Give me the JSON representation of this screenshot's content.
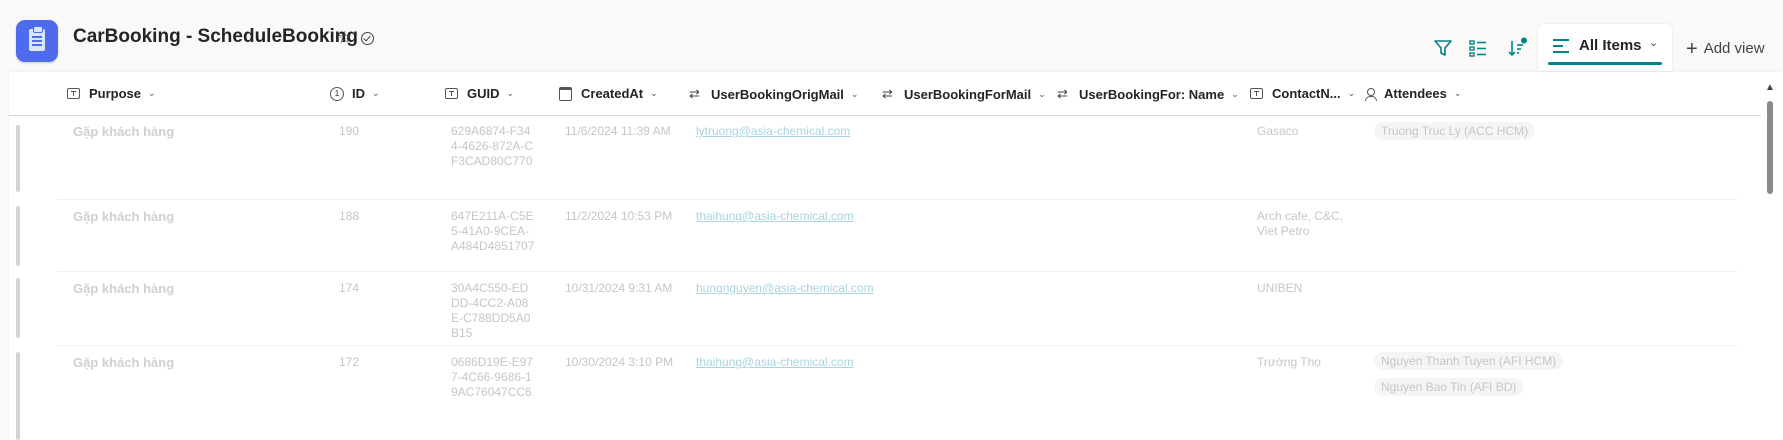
{
  "app": {
    "title": "CarBooking - ScheduleBooking",
    "icon": "clipboard-list-icon",
    "brand_color": "#4f6bed"
  },
  "toolbar": {
    "icons": [
      "filter-icon",
      "group-list-icon",
      "sort-icon"
    ],
    "view_label": "All Items",
    "add_view_label": "Add view",
    "accent_color": "#038387"
  },
  "columns": [
    {
      "label": "Purpose",
      "icon": "text-icon"
    },
    {
      "label": "ID",
      "icon": "number-icon"
    },
    {
      "label": "GUID",
      "icon": "text-icon"
    },
    {
      "label": "CreatedAt",
      "icon": "calendar-icon"
    },
    {
      "label": "UserBookingOrigMail",
      "icon": "lookup-icon"
    },
    {
      "label": "UserBookingForMail",
      "icon": "lookup-icon"
    },
    {
      "label": "UserBookingFor: Name",
      "icon": "lookup-icon"
    },
    {
      "label": "ContactN...",
      "icon": "text-icon"
    },
    {
      "label": "Attendees",
      "icon": "person-icon"
    }
  ],
  "rows": [
    {
      "purpose": "Gặp khách hàng",
      "id": "190",
      "guid": "629A6874-F344-4626-872A-CF3CAD80C770",
      "created": "11/6/2024 11:39 AM",
      "mail": "lytruong@asia-chemical.com",
      "contact": "Gasaco",
      "attendees": [
        "Truong Truc Ly (ACC HCM)"
      ]
    },
    {
      "purpose": "Gặp khách hàng",
      "id": "188",
      "guid": "647E211A-C5E5-41A0-9CEA-A484D4851707",
      "created": "11/2/2024 10:53 PM",
      "mail": "thaihung@asia-chemical.com",
      "contact": "Arch cafe, C&C, Viet Petro",
      "attendees": []
    },
    {
      "purpose": "Gặp khách hàng",
      "id": "174",
      "guid": "30A4C550-EDDD-4CC2-A08E-C788DD5A0B15",
      "created": "10/31/2024 9:31 AM",
      "mail": "hungnguyen@asia-chemical.com",
      "contact": "UNIBEN",
      "attendees": []
    },
    {
      "purpose": "Gặp khách hàng",
      "id": "172",
      "guid": "0686D19E-E977-4C66-9686-19AC76047CC6",
      "created": "10/30/2024 3:10 PM",
      "mail": "thaihung@asia-chemical.com",
      "contact": "Trường Thọ",
      "attendees": [
        "Nguyen Thanh Tuyen (AFI HCM)",
        "Nguyen Bao Tin (AFI BD)"
      ]
    }
  ]
}
